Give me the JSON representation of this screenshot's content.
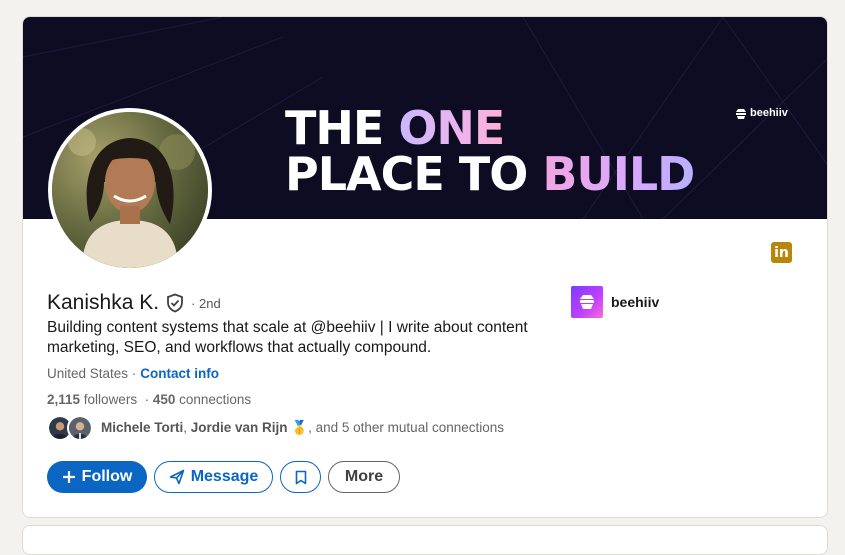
{
  "banner": {
    "line1_a": "THE ",
    "line1_b": "ONE",
    "line2_a": "PLACE TO ",
    "line2_b": "BUILD",
    "logo_text": "beehiiv",
    "background": "#0d0c22"
  },
  "profile": {
    "name": "Kanishka K.",
    "degree": "· 2nd",
    "headline": "Building content systems that scale at @beehiiv | I write about content marketing, SEO, and workflows that actually compound.",
    "location": "United States ·",
    "contact_label": "Contact info",
    "followers_count": "2,115",
    "followers_label": " followers",
    "connections_sep": "  · ",
    "connections_count": "450",
    "connections_label": " connections",
    "mutual_name1": "Michele Torti",
    "mutual_sep": ", ",
    "mutual_name2": "Jordie van Rijn",
    "mutual_emoji": " 🥇",
    "mutual_rest": ", and 5 other mutual connections"
  },
  "company": {
    "name": "beehiiv",
    "accent": "#7b3bff"
  },
  "actions": {
    "follow_label": "Follow",
    "message_label": "Message",
    "more_label": "More"
  },
  "icons": {
    "linkedin": "linkedin-icon",
    "verified": "verified-shield-icon",
    "plus": "plus-icon",
    "send": "send-icon",
    "bookmark": "bookmark-icon"
  },
  "colors": {
    "primary": "#0a66c2",
    "page_bg": "#f4f2ee"
  }
}
